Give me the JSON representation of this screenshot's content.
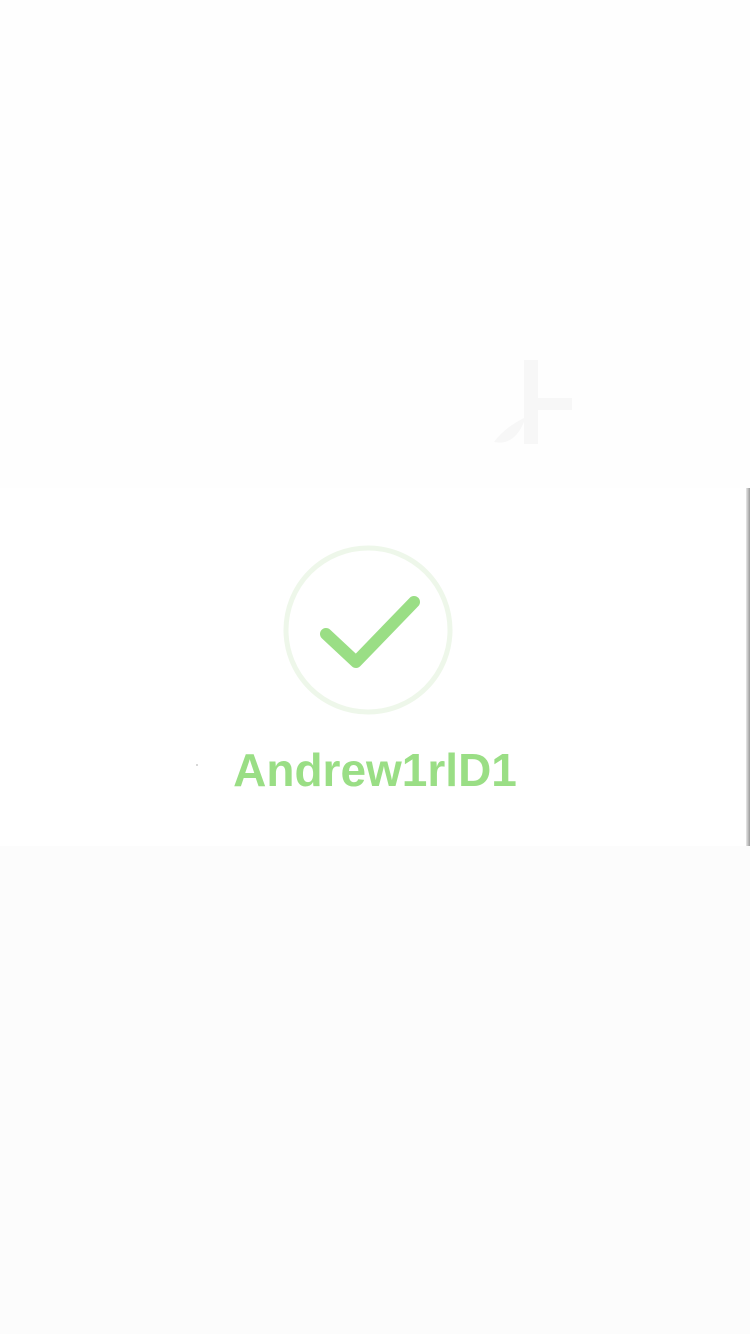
{
  "success": {
    "icon": "checkmark-circle-icon",
    "username": "Andrew1rlD1",
    "accent_color": "#9ade85",
    "ring_color": "#eef7ea"
  },
  "background": {
    "icon": "faint-logo-icon"
  }
}
